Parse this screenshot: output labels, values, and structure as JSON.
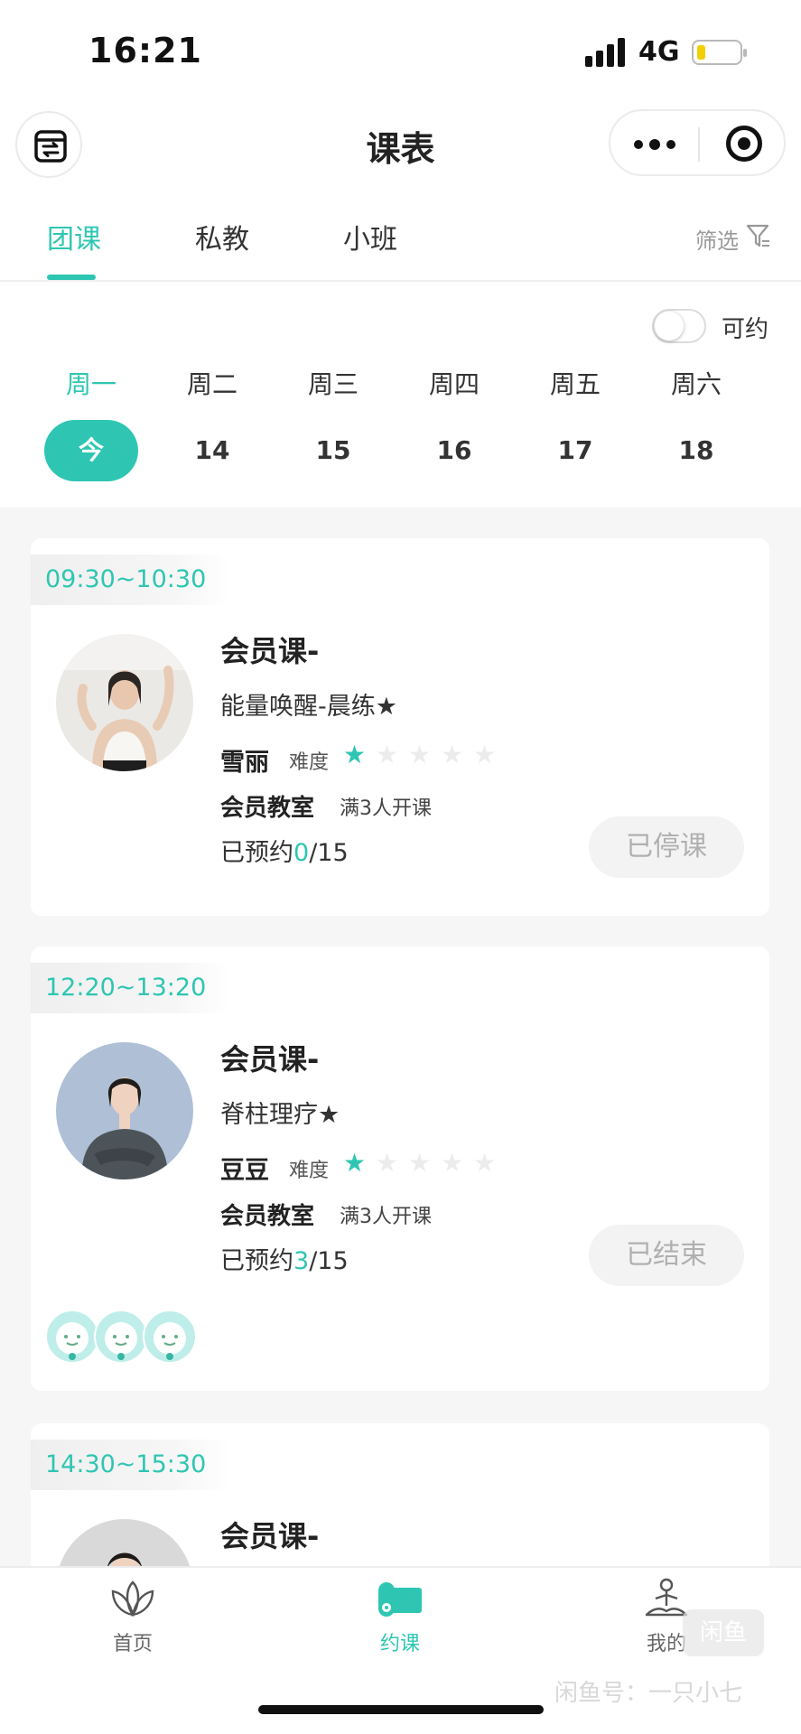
{
  "status_bar": {
    "time": "16:21",
    "network": "4G"
  },
  "navbar": {
    "title": "课表"
  },
  "tabs": [
    {
      "label": "团课",
      "active": true
    },
    {
      "label": "私教",
      "active": false
    },
    {
      "label": "小班",
      "active": false
    }
  ],
  "filter_label": "筛选",
  "available_toggle": {
    "label": "可约",
    "on": false
  },
  "week": [
    {
      "weekday": "周一",
      "date": "今",
      "active": true
    },
    {
      "weekday": "周二",
      "date": "14",
      "active": false
    },
    {
      "weekday": "周三",
      "date": "15",
      "active": false
    },
    {
      "weekday": "周四",
      "date": "16",
      "active": false
    },
    {
      "weekday": "周五",
      "date": "17",
      "active": false
    },
    {
      "weekday": "周六",
      "date": "18",
      "active": false
    }
  ],
  "courses": [
    {
      "time": "09:30~10:30",
      "title": "会员课-",
      "name": "能量唤醒-晨练★",
      "coach": "雪丽",
      "difficulty_label": "难度",
      "difficulty": 1,
      "difficulty_max": 5,
      "room": "会员教室",
      "min_people": "满3人开课",
      "booked_prefix": "已预约",
      "booked": "0",
      "capacity": "/15",
      "status": "已停课"
    },
    {
      "time": "12:20~13:20",
      "title": "会员课-",
      "name": "脊柱理疗★",
      "coach": "豆豆",
      "difficulty_label": "难度",
      "difficulty": 1,
      "difficulty_max": 5,
      "room": "会员教室",
      "min_people": "满3人开课",
      "booked_prefix": "已预约",
      "booked": "3",
      "capacity": "/15",
      "status": "已结束"
    },
    {
      "time": "14:30~15:30",
      "title": "会员课-"
    }
  ],
  "bottom_nav": [
    {
      "label": "首页",
      "icon": "lotus-icon",
      "active": false
    },
    {
      "label": "约课",
      "icon": "yoga-mat-icon",
      "active": true
    },
    {
      "label": "我的",
      "icon": "meditation-person-icon",
      "active": false
    }
  ],
  "watermark": "闲鱼号：一只小七",
  "watermark_logo": "闲鱼",
  "colors": {
    "accent": "#2ec6b2",
    "battery": "#f2cf00"
  }
}
